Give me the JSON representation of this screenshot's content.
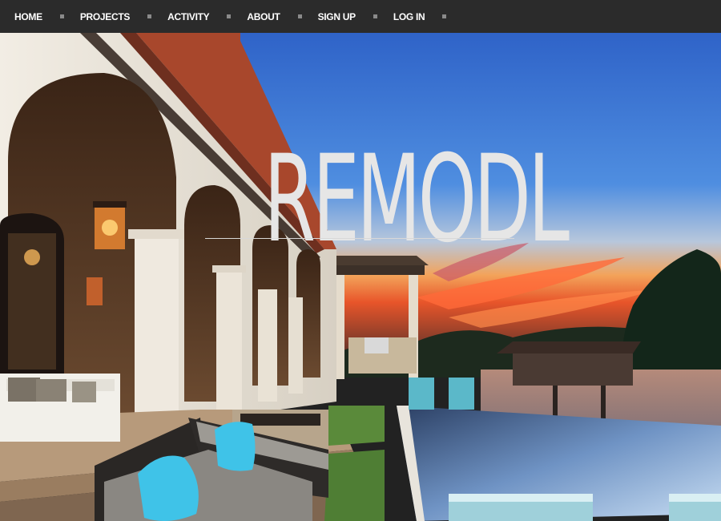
{
  "nav": {
    "items": [
      {
        "label": "HOME"
      },
      {
        "label": "PROJECTS"
      },
      {
        "label": "ACTIVITY"
      },
      {
        "label": "ABOUT"
      },
      {
        "label": "SIGN UP"
      },
      {
        "label": "LOG IN"
      }
    ]
  },
  "hero": {
    "logo": "REMODL"
  },
  "colors": {
    "navbar_bg": "#2b2b2b",
    "nav_text": "#ffffff",
    "nav_separator": "#8a8a8a",
    "logo_text": "#e6e6e6",
    "sky_top": "#2f63c8",
    "pool_water": "#a9c6e8",
    "cushion_accent": "#3fc3e8"
  }
}
